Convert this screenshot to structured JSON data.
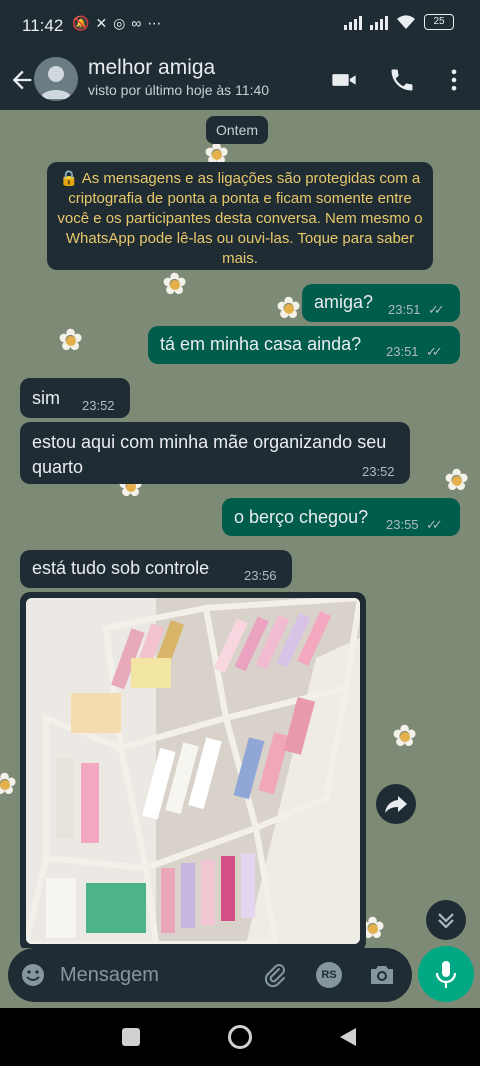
{
  "status_bar": {
    "time": "11:42",
    "battery": "25",
    "notification_icons": [
      "mute-icon",
      "app-icon",
      "instagram-icon",
      "voicemail-icon",
      "more-icon"
    ]
  },
  "header": {
    "contact_name": "melhor amiga",
    "last_seen": "visto por último hoje às 11:40",
    "actions": [
      "video-call-icon",
      "voice-call-icon",
      "menu-icon"
    ]
  },
  "chat": {
    "date_divider": "Ontem",
    "encryption_notice": "🔒 As mensagens e as ligações são protegidas com a criptografia de ponta a ponta e ficam somente entre você e os participantes desta conversa. Nem mesmo o WhatsApp pode lê-las ou ouvi-las. Toque para saber mais.",
    "messages": [
      {
        "direction": "out",
        "text": "amiga?",
        "time": "23:51",
        "status": "read"
      },
      {
        "direction": "out",
        "text": "tá em minha casa ainda?",
        "time": "23:51",
        "status": "read"
      },
      {
        "direction": "in",
        "text": "sim",
        "time": "23:52"
      },
      {
        "direction": "in",
        "text": "estou aqui com minha mãe organizando seu quarto",
        "time": "23:52"
      },
      {
        "direction": "out",
        "text": "o berço chegou?",
        "time": "23:55",
        "status": "read"
      },
      {
        "direction": "in",
        "text": "está tudo sob controle",
        "time": "23:56"
      },
      {
        "direction": "in",
        "type": "image",
        "description": "photo of drawer with baby clothes"
      }
    ],
    "read_ticks": "✓✓"
  },
  "composer": {
    "placeholder": "Mensagem",
    "rs_badge": "RS"
  },
  "colors": {
    "header_bg": "#1f2c34",
    "outgoing_bubble": "#005c4b",
    "incoming_bubble": "#1f2c34",
    "wallpaper": "#7d8b76",
    "accent": "#00a884"
  }
}
